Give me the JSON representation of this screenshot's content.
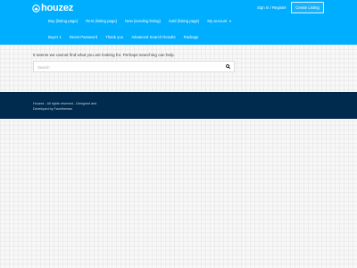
{
  "header": {
    "logo_text": "houzez",
    "login_register": "Sign In / Register",
    "create_listing": "Create Listing",
    "nav_row1": [
      "Buy (listing page)",
      "Rent (listing page)",
      "New (sending listing)",
      "Sold (listing page)"
    ],
    "my_account": "My account",
    "nav_row2": [
      "Buyer 1",
      "Reset Password",
      "Thank you",
      "Advanced Search Results",
      "Package"
    ]
  },
  "main": {
    "not_found_text": "It seems we cannot find what you are looking for. Perhaps searching can help.",
    "search_placeholder": "Search"
  },
  "footer": {
    "copyright": "Houzez - All rights reserved - Designed and",
    "developed_by": "Developed by Favethemes"
  },
  "colors": {
    "header_bg": "#00aeff",
    "footer_bg": "#002b4e"
  }
}
